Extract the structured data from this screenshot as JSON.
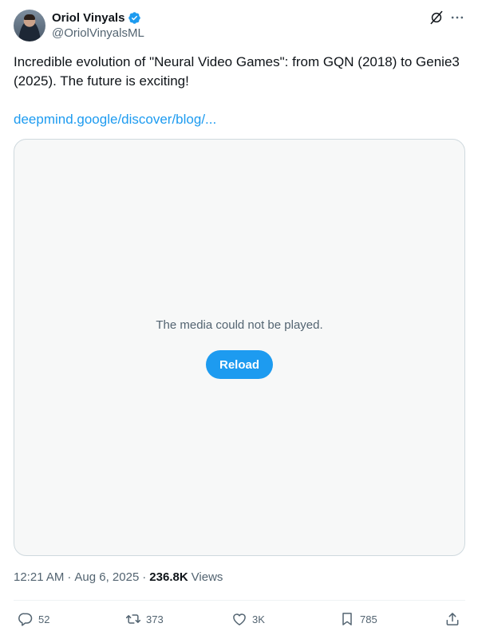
{
  "author": {
    "display_name": "Oriol Vinyals",
    "handle": "@OriolVinyalsML",
    "verified": true
  },
  "tweet": {
    "text": "Incredible evolution of \"Neural Video Games\": from GQN (2018) to Genie3 (2025). The future is exciting!",
    "link_text": "deepmind.google/discover/blog/..."
  },
  "media": {
    "message": "The media could not be played.",
    "reload_label": "Reload"
  },
  "meta": {
    "time": "12:21 AM",
    "sep1": "·",
    "date": "Aug 6, 2025",
    "sep2": "·",
    "views_count": "236.8K",
    "views_label": "Views"
  },
  "actions": {
    "replies": "52",
    "retweets": "373",
    "likes": "3K",
    "bookmarks": "785"
  },
  "icons": [
    "verified-badge-icon",
    "grok-icon",
    "more-icon",
    "reply-icon",
    "retweet-icon",
    "like-icon",
    "bookmark-icon",
    "share-icon"
  ],
  "colors": {
    "accent": "#1d9bf0",
    "text": "#0f1419",
    "secondary": "#536471",
    "media_bg": "#f7f8f8",
    "border": "#cfd9de"
  }
}
